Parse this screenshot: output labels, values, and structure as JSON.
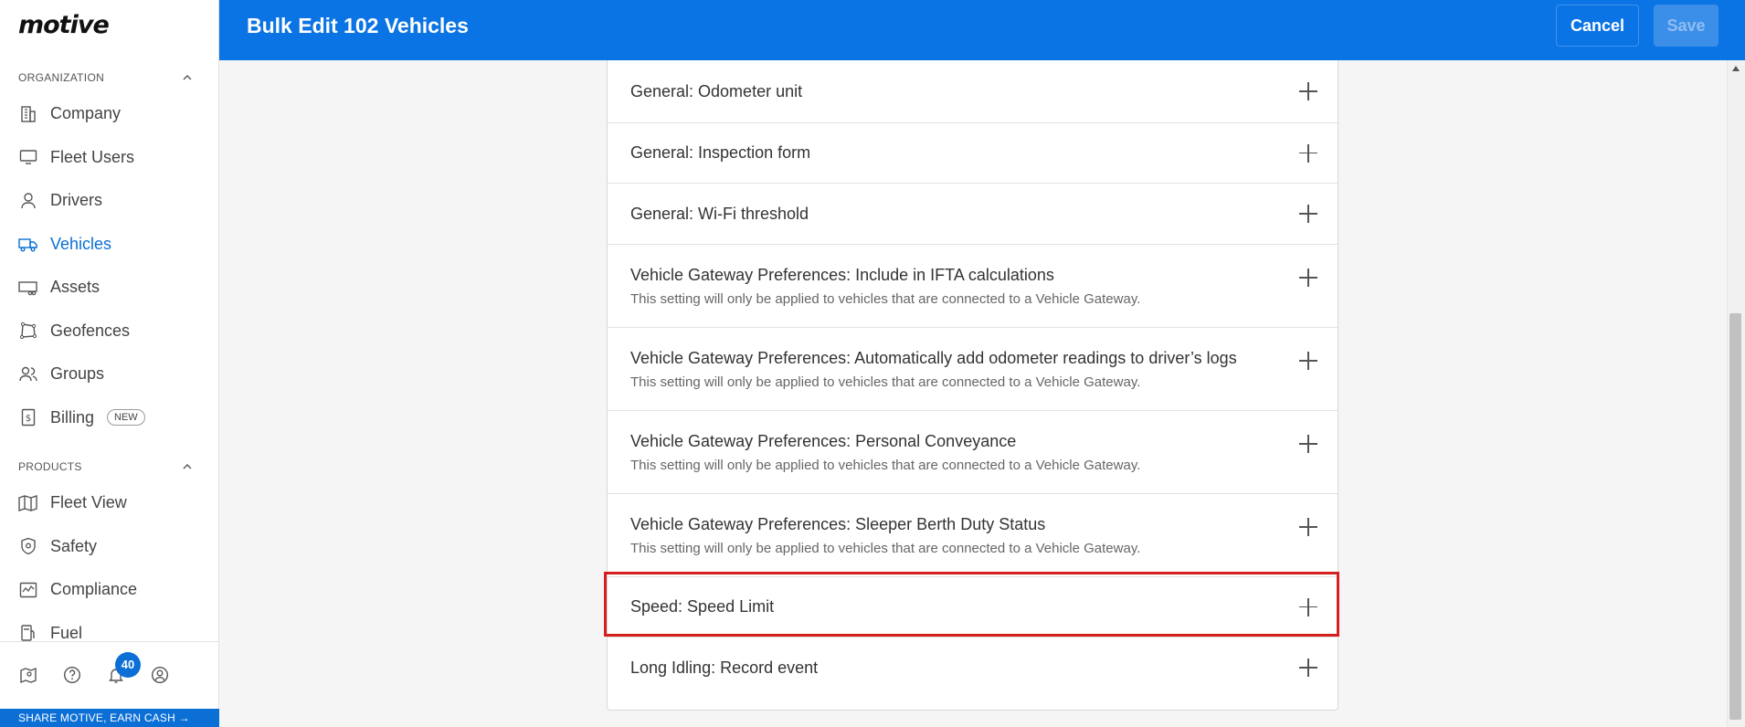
{
  "app": {
    "logo_text": "motive"
  },
  "sidebar": {
    "organization_label": "ORGANIZATION",
    "organization_items": [
      {
        "label": "Company",
        "icon": "building-icon"
      },
      {
        "label": "Fleet Users",
        "icon": "monitor-icon"
      },
      {
        "label": "Drivers",
        "icon": "user-icon"
      },
      {
        "label": "Vehicles",
        "icon": "truck-icon",
        "active": true
      },
      {
        "label": "Assets",
        "icon": "trailer-icon"
      },
      {
        "label": "Geofences",
        "icon": "geofence-icon"
      },
      {
        "label": "Groups",
        "icon": "users-icon"
      },
      {
        "label": "Billing",
        "icon": "bill-icon",
        "badge": "NEW"
      }
    ],
    "products_label": "PRODUCTS",
    "products_items": [
      {
        "label": "Fleet View",
        "icon": "map-icon"
      },
      {
        "label": "Safety",
        "icon": "shield-icon"
      },
      {
        "label": "Compliance",
        "icon": "chart-icon"
      },
      {
        "label": "Fuel",
        "icon": "fuel-icon"
      }
    ],
    "notification_count": "40",
    "share_text": "SHARE MOTIVE, EARN CASH →"
  },
  "header": {
    "title": "Bulk Edit 102 Vehicles",
    "cancel_label": "Cancel",
    "save_label": "Save"
  },
  "settings": [
    {
      "title": "General: Odometer unit",
      "subtitle": ""
    },
    {
      "title": "General: Inspection form",
      "subtitle": ""
    },
    {
      "title": "General: Wi-Fi threshold",
      "subtitle": ""
    },
    {
      "title": "Vehicle Gateway Preferences: Include in IFTA calculations",
      "subtitle": "This setting will only be applied to vehicles that are connected to a Vehicle Gateway."
    },
    {
      "title": "Vehicle Gateway Preferences: Automatically add odometer readings to driver’s logs",
      "subtitle": "This setting will only be applied to vehicles that are connected to a Vehicle Gateway."
    },
    {
      "title": "Vehicle Gateway Preferences: Personal Conveyance",
      "subtitle": "This setting will only be applied to vehicles that are connected to a Vehicle Gateway."
    },
    {
      "title": "Vehicle Gateway Preferences: Sleeper Berth Duty Status",
      "subtitle": "This setting will only be applied to vehicles that are connected to a Vehicle Gateway."
    },
    {
      "title": "Speed: Speed Limit",
      "subtitle": ""
    },
    {
      "title": "Long Idling: Record event",
      "subtitle": ""
    }
  ],
  "colors": {
    "brand_blue": "#0b74e4",
    "highlight_red": "#d61f1f",
    "active_nav": "#0b6fd6"
  }
}
